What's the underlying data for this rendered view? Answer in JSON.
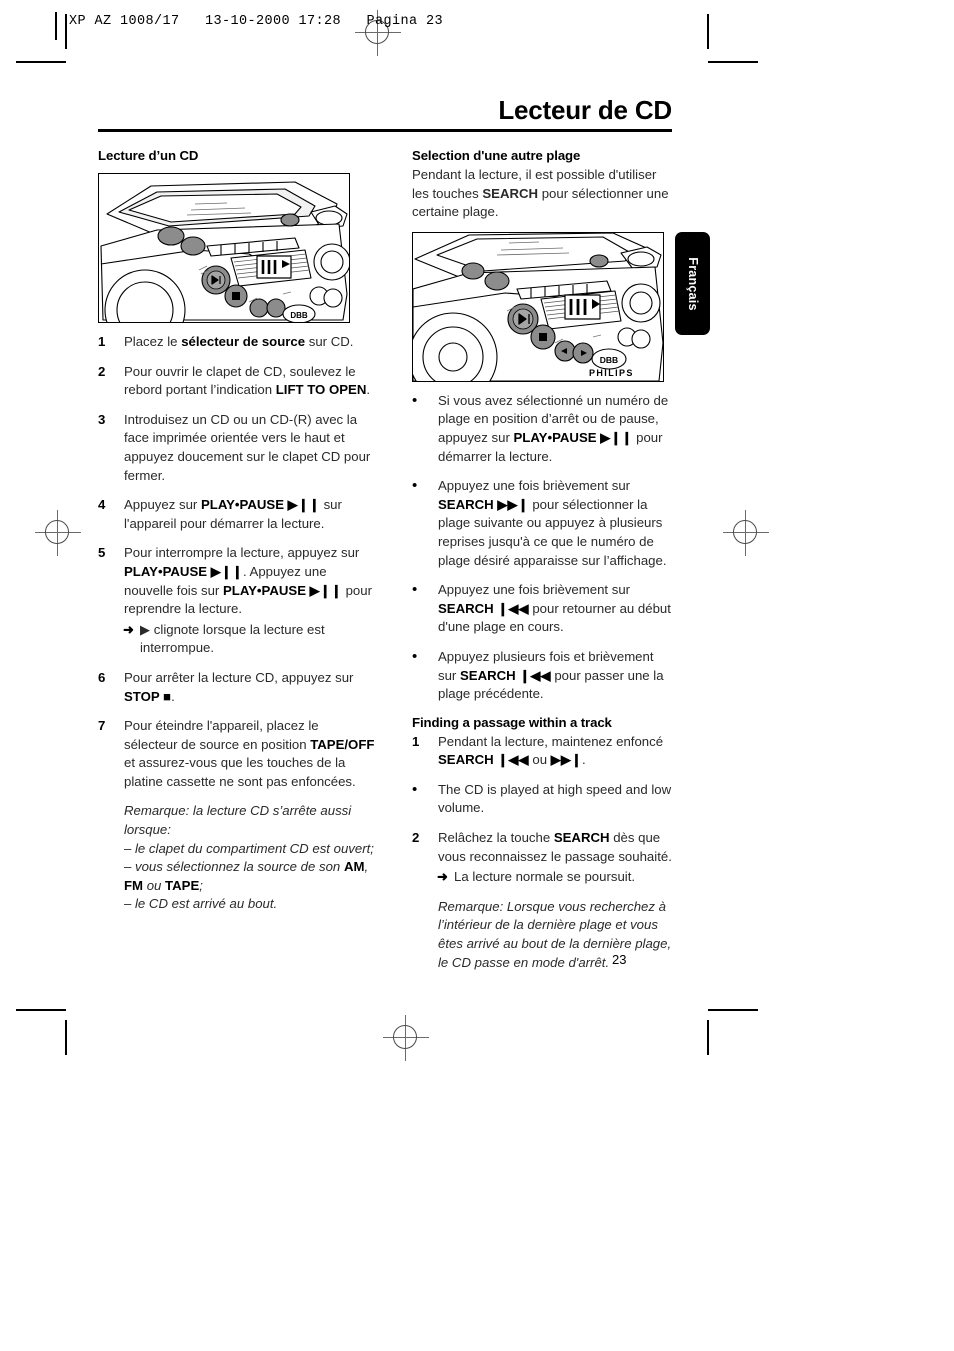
{
  "sheet": {
    "prepress_meta": "XP AZ 1008/17   13-10-2000 17:28   Pagina 23"
  },
  "document": {
    "title": "Lecteur de CD",
    "page_number": "23",
    "language_tab": "Français"
  },
  "left_column": {
    "heading": "Lecture d’un CD",
    "figure_caption": "philips-cd-player-control-panel-illustration",
    "steps": [
      {
        "num": "1",
        "parts": [
          {
            "t": "Placez le ",
            "b": false
          },
          {
            "t": "sélecteur de source",
            "b": true
          },
          {
            "t": " sur CD.",
            "b": false
          }
        ]
      },
      {
        "num": "2",
        "parts": [
          {
            "t": "Pour ouvrir le clapet de CD, soulevez le rebord portant l’indication ",
            "b": false
          },
          {
            "t": "LIFT TO OPEN",
            "b": true
          },
          {
            "t": ".",
            "b": false
          }
        ]
      },
      {
        "num": "3",
        "parts": [
          {
            "t": "Introduisez un CD ou un CD-(R) avec la face imprimée orientée vers le haut et appuyez doucement sur le clapet CD pour fermer.",
            "b": false
          }
        ]
      },
      {
        "num": "4",
        "parts": [
          {
            "t": "Appuyez sur ",
            "b": false
          },
          {
            "t": "PLAY•PAUSE",
            "b": true
          },
          {
            "t": " ▶❙❙",
            "b": true
          },
          {
            "t": " sur l'appareil pour démarrer la lecture.",
            "b": false
          }
        ]
      },
      {
        "num": "5",
        "parts": [
          {
            "t": "Pour interrompre la lecture, appuyez sur ",
            "b": false
          },
          {
            "t": "PLAY•PAUSE ▶❙❙",
            "b": true
          },
          {
            "t": ". Appuyez une nouvelle fois sur ",
            "b": false
          },
          {
            "t": "PLAY•PAUSE ▶❙❙",
            "b": true
          },
          {
            "t": " pour reprendre la lecture.",
            "b": false
          }
        ],
        "sub": "▶ clignote lorsque la lecture est interrompue.",
        "sub_arrow": "➜"
      },
      {
        "num": "6",
        "parts": [
          {
            "t": "Pour arrêter la lecture CD, appuyez sur ",
            "b": false
          },
          {
            "t": "STOP ■",
            "b": true
          },
          {
            "t": ".",
            "b": false
          }
        ]
      },
      {
        "num": "7",
        "parts": [
          {
            "t": "Pour éteindre l'appareil, placez le sélecteur de source en position ",
            "b": false
          },
          {
            "t": "TAPE/OFF",
            "b": true
          },
          {
            "t": " et assurez-vous que les touches de la platine cassette ne sont pas enfoncées.",
            "b": false
          }
        ]
      }
    ],
    "note_lines": [
      [
        {
          "t": "Remarque: la lecture CD s’arrête aussi lorsque:",
          "b": false
        }
      ],
      [
        {
          "t": "– le clapet du compartiment CD est ouvert;",
          "b": false
        }
      ],
      [
        {
          "t": "– vous sélectionnez la source de son ",
          "b": false
        },
        {
          "t": "AM",
          "b": true
        },
        {
          "t": ", ",
          "b": false
        },
        {
          "t": "FM",
          "b": true
        },
        {
          "t": " ou ",
          "b": false
        },
        {
          "t": "TAPE",
          "b": true
        },
        {
          "t": ";",
          "b": false
        }
      ],
      [
        {
          "t": "– le CD est arrivé au bout.",
          "b": false
        }
      ]
    ]
  },
  "right_column": {
    "heading": "Selection d'une autre plage",
    "intro_parts": [
      {
        "t": "Pendant la lecture, il est possible d'utiliser les touches ",
        "b": false
      },
      {
        "t": "SEARCH",
        "b": true
      },
      {
        "t": " pour sélectionner une certaine plage.",
        "b": false
      }
    ],
    "figure_caption": "philips-cd-player-control-panel-illustration",
    "bullets": [
      {
        "marker": "•",
        "parts": [
          {
            "t": "Si vous avez sélectionné un numéro de plage en position d’arrêt ou de pause, appuyez sur ",
            "b": false
          },
          {
            "t": "PLAY•PAUSE ▶❙❙",
            "b": true
          },
          {
            "t": " pour démarrer la lecture.",
            "b": false
          }
        ]
      },
      {
        "marker": "•",
        "parts": [
          {
            "t": "Appuyez une fois brièvement sur ",
            "b": false
          },
          {
            "t": "SEARCH ▶▶❙",
            "b": true
          },
          {
            "t": " pour sélectionner la plage suivante ou appuyez à plusieurs reprises jusqu'à ce que le numéro de plage désiré apparaisse sur l’affichage.",
            "b": false
          }
        ]
      },
      {
        "marker": "•",
        "parts": [
          {
            "t": "Appuyez une fois brièvement sur ",
            "b": false
          },
          {
            "t": "SEARCH ❙◀◀",
            "b": true
          },
          {
            "t": " pour retourner au début d'une plage en cours.",
            "b": false
          }
        ]
      },
      {
        "marker": "•",
        "parts": [
          {
            "t": "Appuyez plusieurs fois et brièvement sur ",
            "b": false
          },
          {
            "t": "SEARCH ❙◀◀",
            "b": true
          },
          {
            "t": " pour passer une la plage précédente.",
            "b": false
          }
        ]
      }
    ],
    "subsection_heading": "Finding a passage within a track",
    "subsection_items": [
      {
        "marker": "1",
        "bold_marker": true,
        "parts": [
          {
            "t": "Pendant la lecture, maintenez enfoncé ",
            "b": false
          },
          {
            "t": "SEARCH",
            "b": true
          },
          {
            "t": " ❙◀◀ ",
            "b": true
          },
          {
            "t": "ou",
            "b": false
          },
          {
            "t": " ▶▶❙",
            "b": true
          },
          {
            "t": ".",
            "b": false
          }
        ]
      },
      {
        "marker": "•",
        "bold_marker": false,
        "parts": [
          {
            "t": "The CD is played at high speed and low volume.",
            "b": false
          }
        ]
      },
      {
        "marker": "2",
        "bold_marker": true,
        "parts": [
          {
            "t": "Relâchez la touche ",
            "b": false
          },
          {
            "t": "SEARCH",
            "b": true
          },
          {
            "t": " dès que vous reconnaissez le passage souhaité.",
            "b": false
          }
        ],
        "sub": "La lecture normale se poursuit.",
        "sub_arrow": "➜"
      }
    ],
    "note_lines": [
      [
        {
          "t": "Remarque: Lorsque vous recherchez à l’intérieur de la dernière plage et vous êtes arrivé au bout de la dernière plage, le CD passe en mode d'arrêt.",
          "b": false
        }
      ]
    ]
  }
}
